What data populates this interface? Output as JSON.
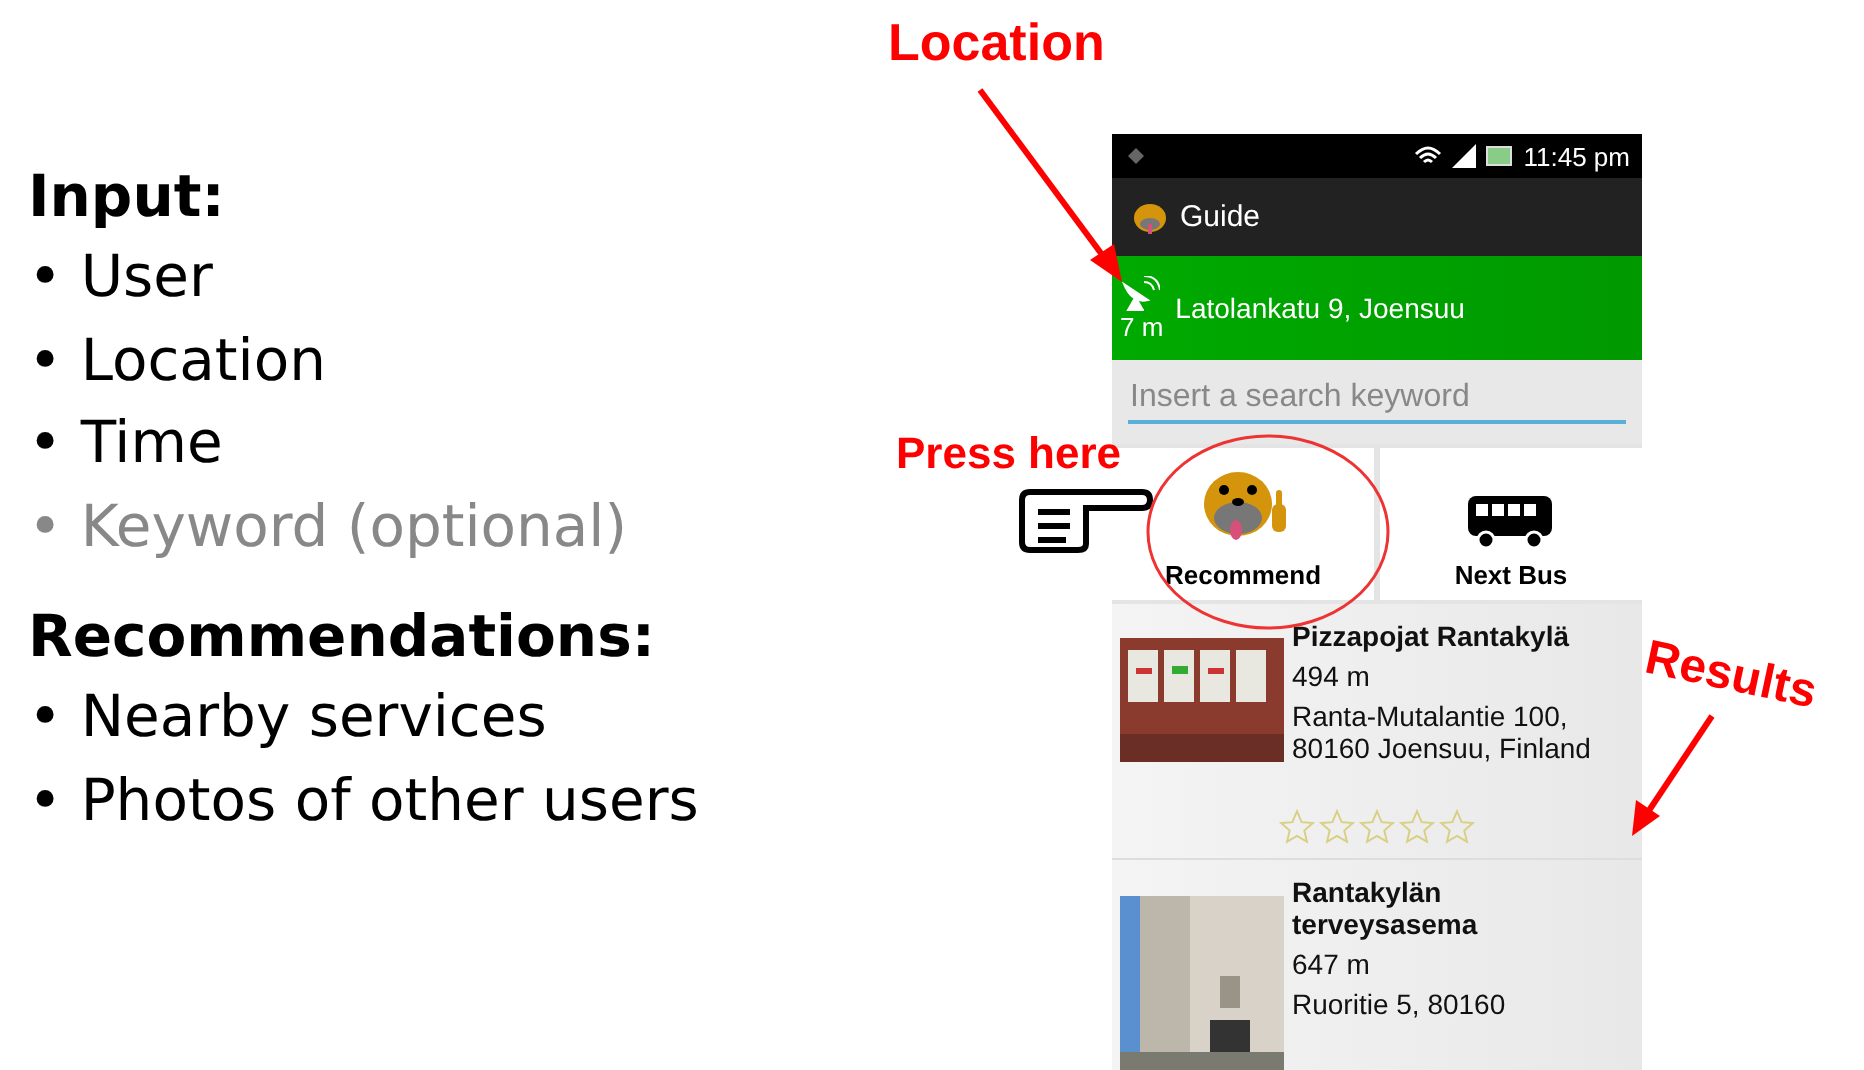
{
  "slide": {
    "sections": [
      {
        "heading": "Input:",
        "items": [
          {
            "text": "• User",
            "dimmed": false
          },
          {
            "text": "• Location",
            "dimmed": false
          },
          {
            "text": "• Time",
            "dimmed": false
          },
          {
            "text": "• Keyword (optional)",
            "dimmed": true
          }
        ]
      },
      {
        "heading": "Recommendations:",
        "items": [
          {
            "text": "• Nearby services",
            "dimmed": false
          },
          {
            "text": "• Photos of other users",
            "dimmed": false
          }
        ]
      }
    ],
    "annotations": [
      {
        "kind": "location",
        "text": "Location"
      },
      {
        "kind": "press",
        "text": "Press here"
      },
      {
        "kind": "results",
        "text": "Results"
      }
    ]
  },
  "phone": {
    "status_bar": {
      "time": "11:45 pm"
    },
    "app_bar": {
      "title": "Guide"
    },
    "location": {
      "address": "Latolankatu 9, Joensuu",
      "accuracy": "7 m"
    },
    "search": {
      "placeholder": "Insert a search keyword"
    },
    "actions": [
      {
        "kind": "recommend",
        "label": "Recommend"
      },
      {
        "kind": "bus",
        "label": "Next Bus"
      }
    ],
    "results": [
      {
        "kind": "picture",
        "name": "Pizzapojat Rantakylä",
        "distance": "494 m",
        "address": "Ranta-Mutalantie 100, 80160 Joensuu, Finland",
        "stars": 0
      },
      {
        "kind": "picture",
        "name": "Rantakylän terveysasema",
        "distance": "647 m",
        "address": "Ruoritie 5, 80160"
      }
    ]
  }
}
